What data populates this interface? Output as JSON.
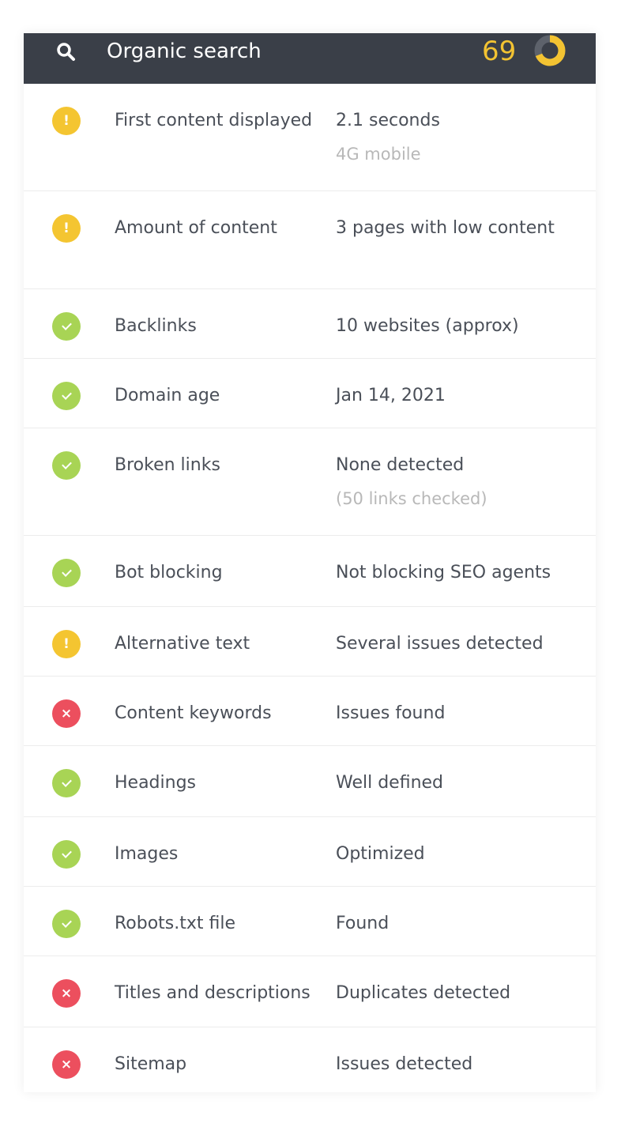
{
  "header": {
    "icon": "search-icon",
    "title": "Organic search",
    "score": "69",
    "score_fraction": 0.69,
    "score_color": "#f3c332",
    "background_color": "#3a3f48"
  },
  "status_colors": {
    "warning": "#f4c531",
    "ok": "#a8d455",
    "error": "#ec4f5e"
  },
  "rows": [
    {
      "status": "warning",
      "icon": "warning-icon",
      "label": "First content displayed",
      "value": "2.1 seconds",
      "subvalue": "4G mobile"
    },
    {
      "status": "warning",
      "icon": "warning-icon",
      "label": "Amount of content",
      "value": "3 pages with low content"
    },
    {
      "status": "ok",
      "icon": "check-icon",
      "label": "Backlinks",
      "value": "10 websites (approx)"
    },
    {
      "status": "ok",
      "icon": "check-icon",
      "label": "Domain age",
      "value": "Jan 14, 2021"
    },
    {
      "status": "ok",
      "icon": "check-icon",
      "label": "Broken links",
      "value": "None detected",
      "subvalue": "(50 links checked)"
    },
    {
      "status": "ok",
      "icon": "check-icon",
      "label": "Bot blocking",
      "value": "Not blocking SEO agents"
    },
    {
      "status": "warning",
      "icon": "warning-icon",
      "label": "Alternative text",
      "value": "Several issues detected"
    },
    {
      "status": "error",
      "icon": "error-icon",
      "label": "Content keywords",
      "value": "Issues found"
    },
    {
      "status": "ok",
      "icon": "check-icon",
      "label": "Headings",
      "value": "Well defined"
    },
    {
      "status": "ok",
      "icon": "check-icon",
      "label": "Images",
      "value": "Optimized"
    },
    {
      "status": "ok",
      "icon": "check-icon",
      "label": "Robots.txt file",
      "value": "Found"
    },
    {
      "status": "error",
      "icon": "error-icon",
      "label": "Titles and descriptions",
      "value": "Duplicates detected"
    },
    {
      "status": "error",
      "icon": "error-icon",
      "label": "Sitemap",
      "value": "Issues detected"
    }
  ]
}
